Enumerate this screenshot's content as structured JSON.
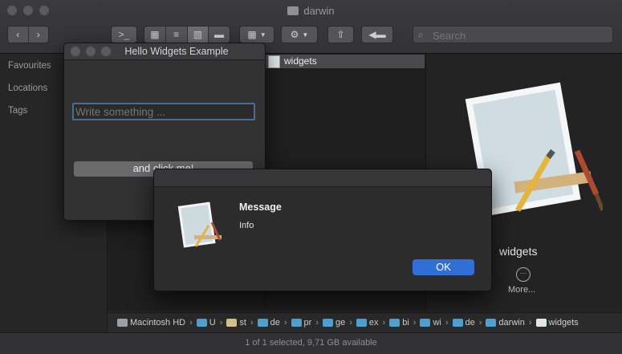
{
  "finder": {
    "title": "darwin",
    "search_placeholder": "Search",
    "sidebar": [
      "Favourites",
      "Locations",
      "Tags"
    ],
    "selected_item": "widgets",
    "preview_name": "widgets",
    "more_label": "More...",
    "path": [
      "Macintosh HD",
      "U",
      "st",
      "de",
      "pr",
      "ge",
      "ex",
      "bi",
      "wi",
      "de",
      "darwin",
      "widgets"
    ],
    "status": "1 of 1 selected, 9,71 GB available"
  },
  "hello_window": {
    "title": "Hello Widgets Example",
    "input_placeholder": "Write something ...",
    "button_label": "and click me!"
  },
  "message_dialog": {
    "title": "Message",
    "text": "Info",
    "ok_label": "OK"
  },
  "colors": {
    "accent": "#2f6fd6",
    "background": "#1e1e1e"
  }
}
